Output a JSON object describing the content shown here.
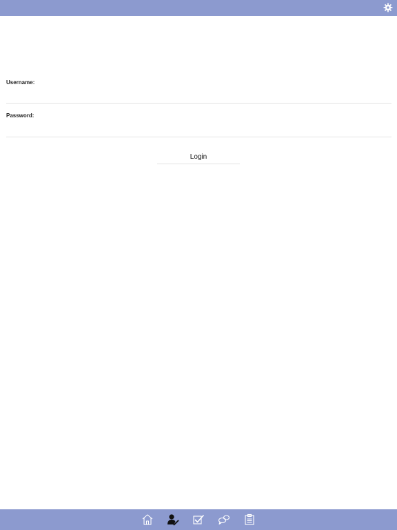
{
  "header": {
    "settings_icon": "gear-icon",
    "bar_color": "#8c9acf"
  },
  "login_form": {
    "username_label": "Username:",
    "username_value": "",
    "password_label": "Password:",
    "password_value": "",
    "login_label": "Login"
  },
  "tab_bar": {
    "bar_color": "#8c9acf",
    "tabs": [
      {
        "icon": "home-icon",
        "active": false
      },
      {
        "icon": "user-edit-icon",
        "active": true
      },
      {
        "icon": "checkbox-icon",
        "active": false
      },
      {
        "icon": "chat-bubbles-icon",
        "active": false
      },
      {
        "icon": "clipboard-list-icon",
        "active": false
      }
    ]
  }
}
